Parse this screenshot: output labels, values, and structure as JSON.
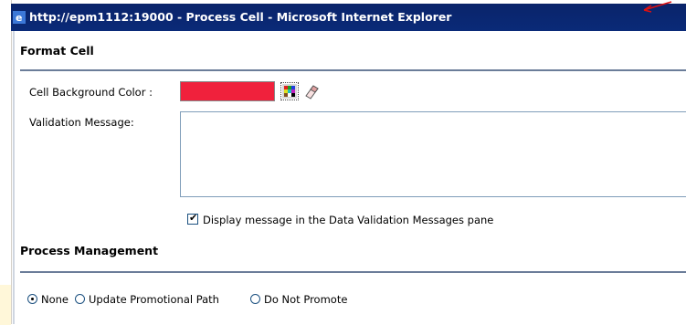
{
  "window": {
    "title": "http://epm1112:19000 - Process Cell - Microsoft Internet Explorer"
  },
  "format_cell": {
    "heading": "Format Cell",
    "background_color_label": "Cell Background Color :",
    "background_color_value": "#f0213c",
    "palette_icon": "color-palette-icon",
    "eraser_icon": "eraser-icon",
    "validation_message_label": "Validation Message:",
    "validation_message_value": "",
    "display_message_checkbox_label": "Display message in the Data Validation Messages pane",
    "display_message_checked": true
  },
  "process_management": {
    "heading": "Process Management",
    "options": [
      "None",
      "Update Promotional Path",
      "Do Not Promote"
    ],
    "selected_index": 0
  }
}
